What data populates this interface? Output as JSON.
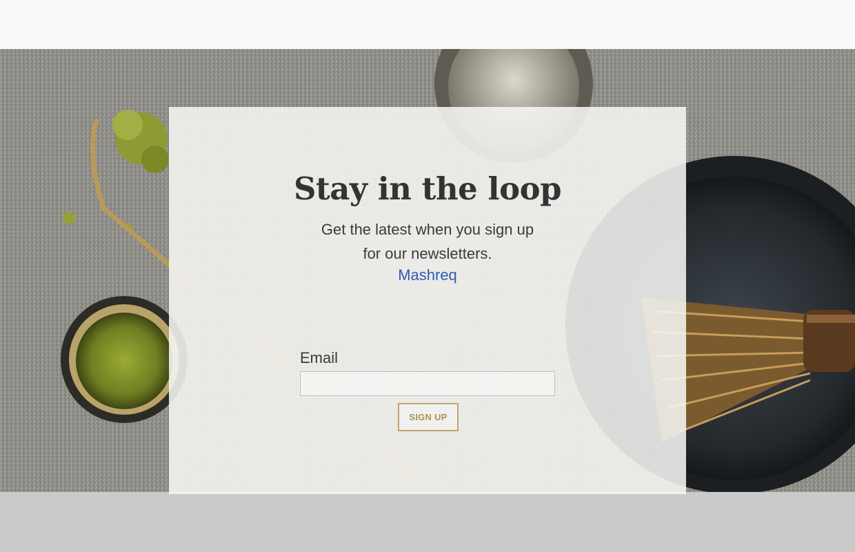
{
  "newsletter": {
    "title": "Stay in the loop",
    "subtitle_line1": "Get the latest when you sign up",
    "subtitle_line2": "for our newsletters.",
    "brand_link": "Mashreq",
    "email_label": "Email",
    "email_value": "",
    "email_placeholder": "",
    "signup_label": "SIGN UP"
  },
  "colors": {
    "title": "#333333",
    "link": "#2d5bb9",
    "button_border": "#c2a46a",
    "button_text": "#b09356",
    "page_background": "#cacaca"
  },
  "hero_image": {
    "subject": "matcha tea bowls, bamboo whisk and scoop on grey stone"
  }
}
